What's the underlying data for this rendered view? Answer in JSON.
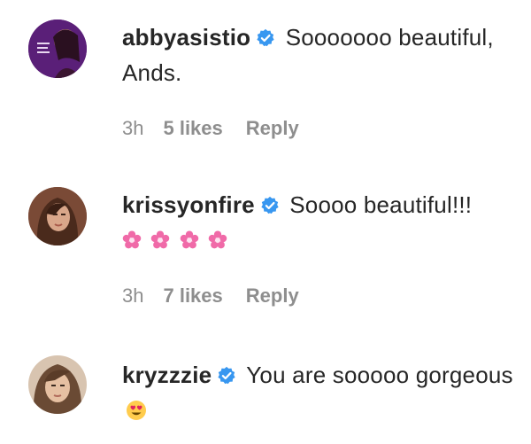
{
  "comments": [
    {
      "username": "abbyasistio",
      "text": "Sooooooo beautiful, Ands.",
      "time": "3h",
      "likes": "5 likes",
      "reply": "Reply",
      "avatar_color": "#6b2a86"
    },
    {
      "username": "krissyonfire",
      "text": "Soooo beautiful!!!",
      "emoji": "cherry-blossom-icon x4",
      "time": "3h",
      "likes": "7 likes",
      "reply": "Reply",
      "avatar_color": "#8a5a43"
    },
    {
      "username": "kryzzzie",
      "text": "You are sooooo gorgeous",
      "emoji": "heart-eyes-icon",
      "avatar_color": "#c9a88a"
    }
  ],
  "colors": {
    "text": "#262626",
    "meta": "#8e8e8e",
    "verified": "#3897f0",
    "blossom": "#f06aa8"
  }
}
